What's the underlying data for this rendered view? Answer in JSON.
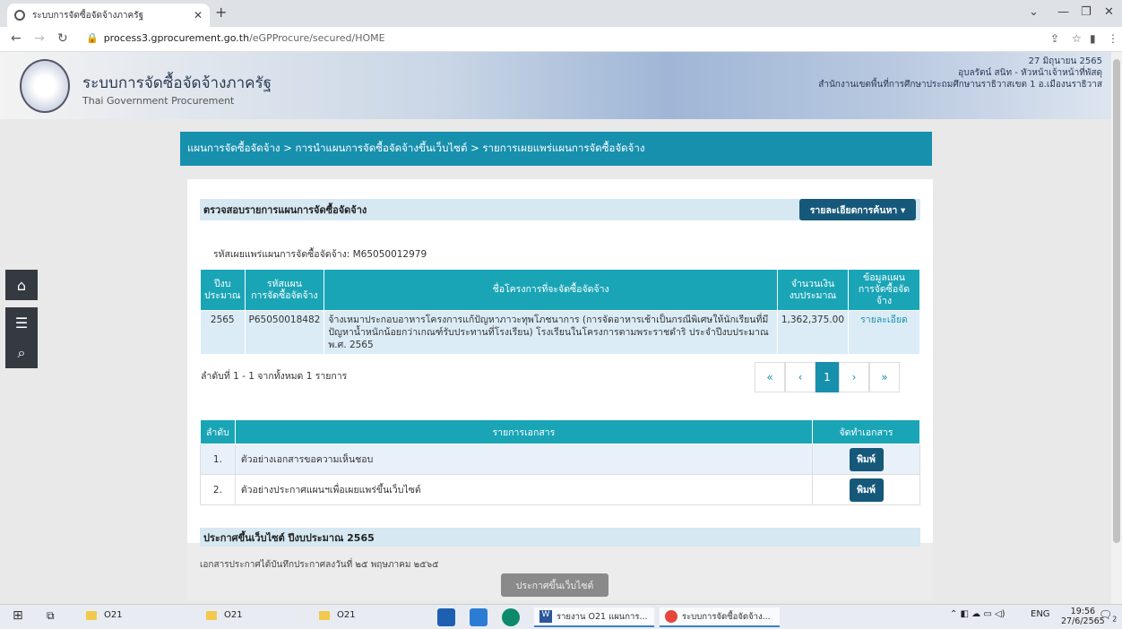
{
  "browser": {
    "tab_title": "ระบบการจัดซื้อจัดจ้างภาครัฐ",
    "new_tab": "+",
    "url_domain": "process3.gprocurement.go.th",
    "url_path": "/eGPProcure/secured/HOME"
  },
  "header": {
    "title": "ระบบการจัดซื้อจัดจ้างภาครัฐ",
    "subtitle": "Thai Government Procurement",
    "date": "27 มิถุนายน 2565",
    "user": "อุบลรัตน์ สนิท - หัวหน้าเจ้าหน้าที่พัสดุ",
    "org": "สำนักงานเขตพื้นที่การศึกษาประถมศึกษานราธิวาสเขต 1 อ.เมืองนราธิวาส"
  },
  "breadcrumb": "แผนการจัดซื้อจัดจ้าง > การนำแผนการจัดซื้อจัดจ้างขึ้นเว็บไซต์ > รายการเผยแพร่แผนการจัดซื้อจัดจ้าง",
  "plan_section": {
    "title": "ตรวจสอบรายการแผนการจัดซื้อจัดจ้าง",
    "search_button": "รายละเอียดการค้นหา ▾",
    "ref_code": "รหัสเผยแพร่แผนการจัดซื้อจัดจ้าง: M65050012979",
    "columns": [
      "ปีงบประมาณ",
      "รหัสแผนการจัดซื้อจัดจ้าง",
      "ชื่อโครงการที่จะจัดซื้อจัดจ้าง",
      "จำนวนเงินงบประมาณ",
      "ข้อมูลแผนการจัดซื้อจัดจ้าง"
    ],
    "col_year_1": "ปีงบ",
    "col_year_2": "ประมาณ",
    "col_code_1": "รหัสแผน",
    "col_code_2": "การจัดซื้อจัดจ้าง",
    "col_amount_1": "จำนวนเงิน",
    "col_amount_2": "งบประมาณ",
    "col_info_1": "ข้อมูลแผน",
    "col_info_2": "การจัดซื้อจัดจ้าง",
    "row": {
      "year": "2565",
      "code": "P65050018482",
      "name": "จ้างเหมาประกอบอาหารโครงการแก้ปัญหาภาวะทุพโภชนาการ (การจัดอาหารเช้าเป็นกรณีพิเศษให้นักเรียนที่มีปัญหาน้ำหนักน้อยกว่าเกณฑ์รับประทานที่โรงเรียน) โรงเรียนในโครงการตามพระราชดำริ ประจำปีงบประมาณ พ.ศ. 2565",
      "amount": "1,362,375.00",
      "info": "รายละเอียด"
    },
    "count_text": "ลำดับที่ 1 - 1 จากทั้งหมด 1 รายการ",
    "pager": {
      "first": "«",
      "prev": "‹",
      "current": "1",
      "next": "›",
      "last": "»"
    }
  },
  "docs_section": {
    "col_no": "ลำดับ",
    "col_doc": "รายการเอกสาร",
    "col_action": "จัดทำเอกสาร",
    "rows": [
      {
        "no": "1.",
        "name": "ตัวอย่างเอกสารขอความเห็นชอบ",
        "action": "พิมพ์"
      },
      {
        "no": "2.",
        "name": "ตัวอย่างประกาศแผนฯเพื่อเผยแพร่ขึ้นเว็บไซต์",
        "action": "พิมพ์"
      }
    ]
  },
  "announce": {
    "title": "ประกาศขึ้นเว็บไซต์ ปีงบประมาณ 2565",
    "text": "เอกสารประกาศได้บันทึกประกาศลงวันที่ ๒๕ พฤษภาคม ๒๕๖๕",
    "button": "ประกาศขึ้นเว็บไซต์"
  },
  "taskbar": {
    "folders": [
      "O21",
      "O21",
      "O21"
    ],
    "word_item": "รายงาน O21 แผนการ...",
    "chrome_item": "ระบบการจัดซื้อจัดจ้าง...",
    "lang": "ENG",
    "time": "19:56",
    "date": "27/6/2565",
    "notif_count": "2"
  }
}
